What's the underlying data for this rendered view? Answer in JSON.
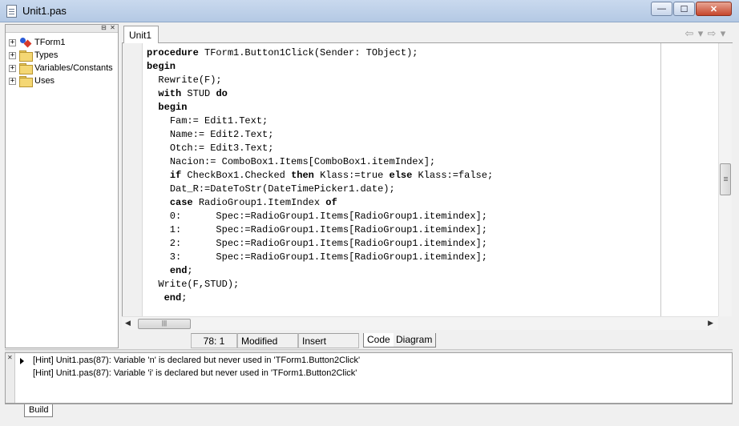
{
  "window": {
    "title": "Unit1.pas",
    "min_glyph": "—",
    "max_glyph": "☐",
    "close_glyph": "✕"
  },
  "tree": {
    "header_pin": "⊟",
    "header_close": "✕",
    "items": [
      {
        "label": "TForm1",
        "icon": "form-icon",
        "expander": "+"
      },
      {
        "label": "Types",
        "icon": "folder-icon",
        "expander": "+"
      },
      {
        "label": "Variables/Constants",
        "icon": "folder-icon",
        "expander": "+"
      },
      {
        "label": "Uses",
        "icon": "folder-icon",
        "expander": "+"
      }
    ]
  },
  "editor": {
    "tab_label": "Unit1",
    "nav": {
      "back": "⇦",
      "back_drop": "▾",
      "forward": "⇨",
      "forward_drop": "▾"
    },
    "code_lines": [
      "procedure TForm1.Button1Click(Sender: TObject);",
      "begin",
      "  Rewrite(F);",
      "  with STUD do",
      "  begin",
      "    Fam:= Edit1.Text;",
      "    Name:= Edit2.Text;",
      "    Otch:= Edit3.Text;",
      "    Nacion:= ComboBox1.Items[ComboBox1.itemIndex];",
      "    if CheckBox1.Checked then Klass:=true else Klass:=false;",
      "    Dat_R:=DateToStr(DateTimePicker1.date);",
      "    case RadioGroup1.ItemIndex of",
      "    0:      Spec:=RadioGroup1.Items[RadioGroup1.itemindex];",
      "    1:      Spec:=RadioGroup1.Items[RadioGroup1.itemindex];",
      "    2:      Spec:=RadioGroup1.Items[RadioGroup1.itemindex];",
      "    3:      Spec:=RadioGroup1.Items[RadioGroup1.itemindex];",
      "    end;",
      "  Write(F,STUD);",
      "   end;"
    ],
    "keywords": [
      "procedure",
      "begin",
      "with",
      "do",
      "if",
      "then",
      "else",
      "case",
      "of",
      "end"
    ],
    "hscroll_left": "◀",
    "hscroll_right": "▶",
    "hscroll_grip": "|||"
  },
  "status": {
    "position": "78:  1",
    "modified": "Modified",
    "mode": "Insert",
    "tab_code": "Code",
    "tab_diagram": "Diagram"
  },
  "messages": {
    "close": "✕",
    "items": [
      "[Hint] Unit1.pas(87): Variable 'n' is declared but never used in 'TForm1.Button2Click'",
      "[Hint] Unit1.pas(87): Variable 'i' is declared but never used in 'TForm1.Button2Click'"
    ],
    "tab_build": "Build"
  }
}
